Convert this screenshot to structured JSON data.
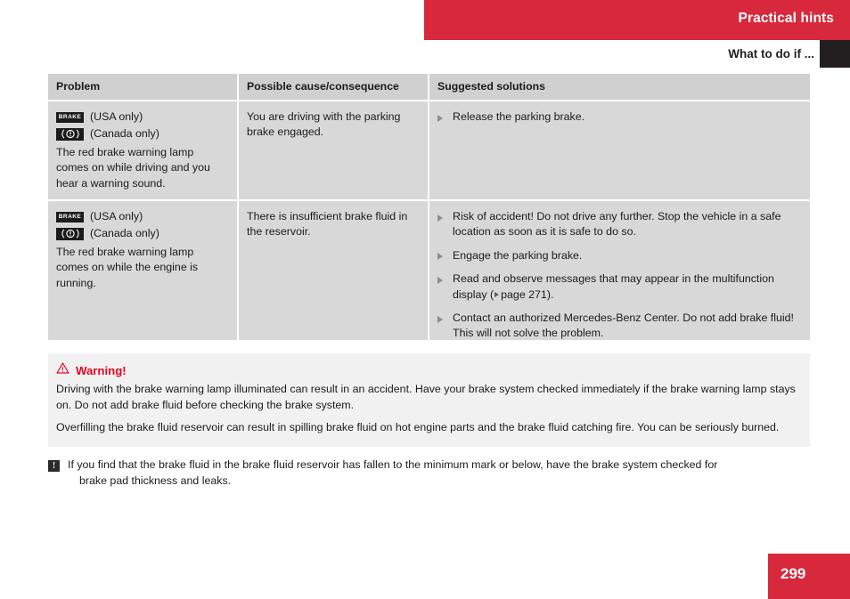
{
  "header": {
    "chapter": "Practical hints",
    "section": "What to do if ...",
    "band_color": "#d8283c",
    "tab_color": "#231f20"
  },
  "table": {
    "columns": [
      "Problem",
      "Possible cause/consequence",
      "Suggested solutions"
    ],
    "rows": [
      {
        "problem": {
          "symbols": [
            {
              "icon": "brake-warning-lamp-usa-icon",
              "label": "BRAKE",
              "note": "(USA only)"
            },
            {
              "icon": "brake-warning-lamp-canada-icon",
              "label": "",
              "note": "(Canada only)"
            }
          ],
          "text": "The red brake warning lamp comes on while driving and you hear a warning sound."
        },
        "cause": "You are driving with the parking brake engaged.",
        "solutions": [
          {
            "text": "Release the parking brake."
          }
        ]
      },
      {
        "problem": {
          "symbols": [
            {
              "icon": "brake-warning-lamp-usa-icon",
              "label": "BRAKE",
              "note": "(USA only)"
            },
            {
              "icon": "brake-warning-lamp-canada-icon",
              "label": "",
              "note": "(Canada only)"
            }
          ],
          "text": "The red brake warning lamp comes on while the engine is running."
        },
        "cause": "There is insufficient brake fluid in the reservoir.",
        "solutions": [
          {
            "text": "Risk of accident! Do not drive any further. Stop the vehicle in a safe location as soon as it is safe to do so."
          },
          {
            "text": "Engage the parking brake."
          },
          {
            "text_before": "Read and observe messages that may appear in the multifunction display (",
            "ref_page": "page 271",
            "text_after": ")."
          },
          {
            "text": "Contact an authorized Mercedes-Benz Center. Do not add brake fluid! This will not solve the problem."
          }
        ]
      }
    ]
  },
  "warning": {
    "icon": "warning-triangle-icon",
    "title": "Warning!",
    "title_color": "#e1051e",
    "paragraphs": [
      "Driving with the brake warning lamp illuminated can result in an accident. Have your brake system checked immediately if the brake warning lamp stays on. Do not add brake fluid before checking the brake system.",
      "Overfilling the brake fluid reservoir can result in spilling brake fluid on hot engine parts and the brake fluid catching fire. You can be seriously burned."
    ]
  },
  "note": {
    "icon": "note-exclamation-icon",
    "icon_glyph": "!",
    "line1": "If you find that the brake fluid in the brake fluid reservoir has fallen to the minimum mark or below, have the brake system checked for",
    "line2": "brake pad thickness and leaks."
  },
  "footer": {
    "page_number": "299",
    "band_color": "#d8283c"
  }
}
